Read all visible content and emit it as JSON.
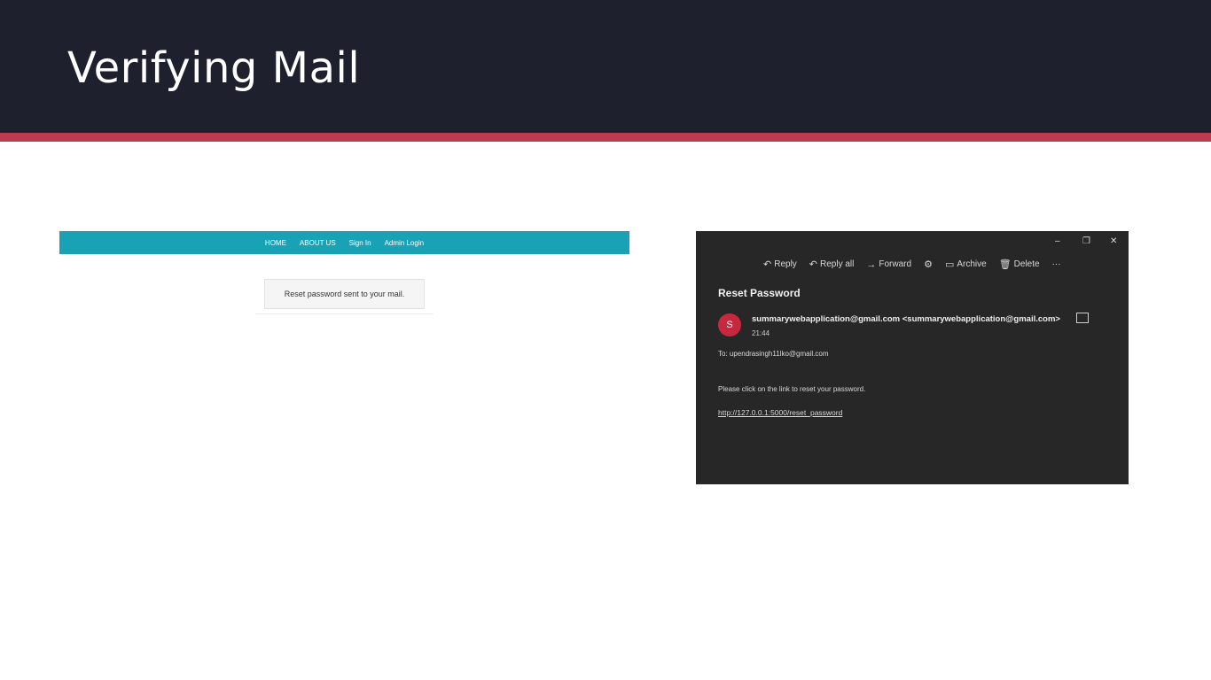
{
  "slide": {
    "title": "Verifying Mail"
  },
  "webapp": {
    "nav": [
      "HOME",
      "ABOUT US",
      "Sign In",
      "Admin Login"
    ],
    "flash_message": "Reset password sent to your mail."
  },
  "mail": {
    "window_controls": {
      "minimize": "–",
      "restore": "❐",
      "close": "✕"
    },
    "toolbar": {
      "reply": "Reply",
      "reply_all": "Reply all",
      "forward": "Forward",
      "archive": "Archive",
      "delete": "Delete",
      "more": "···"
    },
    "subject": "Reset Password",
    "avatar_letter": "S",
    "sender": "summarywebapplication@gmail.com <summarywebapplication@gmail.com>",
    "time": "21:44",
    "to": "To: upendrasingh11lko@gmail.com",
    "body": "Please click on the link to reset your password.",
    "link": "http://127.0.0.1:5000/reset_password"
  },
  "colors": {
    "header_bg": "#1f202d",
    "accent": "#c03a4f",
    "nav_bg": "#19a2b6",
    "mail_bg": "#272727",
    "avatar": "#c8283e"
  }
}
